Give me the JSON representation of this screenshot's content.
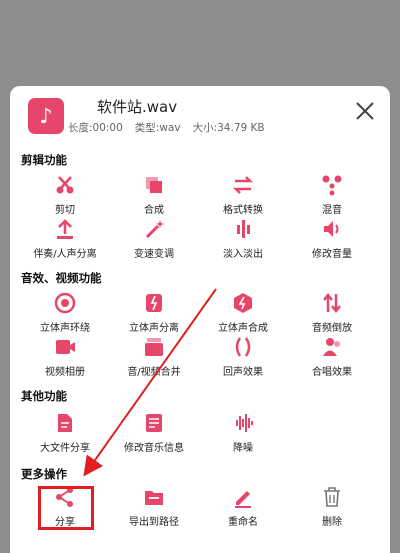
{
  "accent_color": "#e5466a",
  "file": {
    "name": "软件站.wav",
    "duration": "长度:00:00",
    "type": "类型:wav",
    "size": "大小:34.79 KB",
    "icon": "music-note-icon"
  },
  "sections": [
    {
      "title": "剪辑功能",
      "items": [
        {
          "label": "剪切",
          "icon": "scissors-icon"
        },
        {
          "label": "合成",
          "icon": "merge-icon"
        },
        {
          "label": "格式转换",
          "icon": "convert-arrows-icon"
        },
        {
          "label": "混音",
          "icon": "mix-dots-icon"
        },
        {
          "label": "伴奏/人声分离",
          "icon": "upload-separate-icon"
        },
        {
          "label": "变速变调",
          "icon": "magic-wand-icon"
        },
        {
          "label": "淡入淡出",
          "icon": "fade-bars-icon"
        },
        {
          "label": "修改音量",
          "icon": "volume-icon"
        }
      ]
    },
    {
      "title": "音效、视频功能",
      "items": [
        {
          "label": "立体声环绕",
          "icon": "surround-icon"
        },
        {
          "label": "立体声分离",
          "icon": "stereo-split-icon"
        },
        {
          "label": "立体声合成",
          "icon": "stereo-merge-icon"
        },
        {
          "label": "音频倒放",
          "icon": "reverse-icon"
        },
        {
          "label": "视频相册",
          "icon": "video-album-icon"
        },
        {
          "label": "音/视频合并",
          "icon": "av-merge-icon"
        },
        {
          "label": "回声效果",
          "icon": "echo-parentheses-icon"
        },
        {
          "label": "合唱效果",
          "icon": "chorus-people-icon"
        }
      ]
    },
    {
      "title": "其他功能",
      "items": [
        {
          "label": "大文件分享",
          "icon": "file-share-icon"
        },
        {
          "label": "修改音乐信息",
          "icon": "edit-info-icon"
        },
        {
          "label": "降噪",
          "icon": "denoise-wave-icon"
        }
      ]
    },
    {
      "title": "更多操作",
      "items": [
        {
          "label": "分享",
          "icon": "share-icon"
        },
        {
          "label": "导出到路径",
          "icon": "folder-export-icon"
        },
        {
          "label": "重命名",
          "icon": "rename-pen-icon"
        },
        {
          "label": "删除",
          "icon": "trash-icon"
        }
      ]
    }
  ],
  "annotation_color": "#e02020"
}
